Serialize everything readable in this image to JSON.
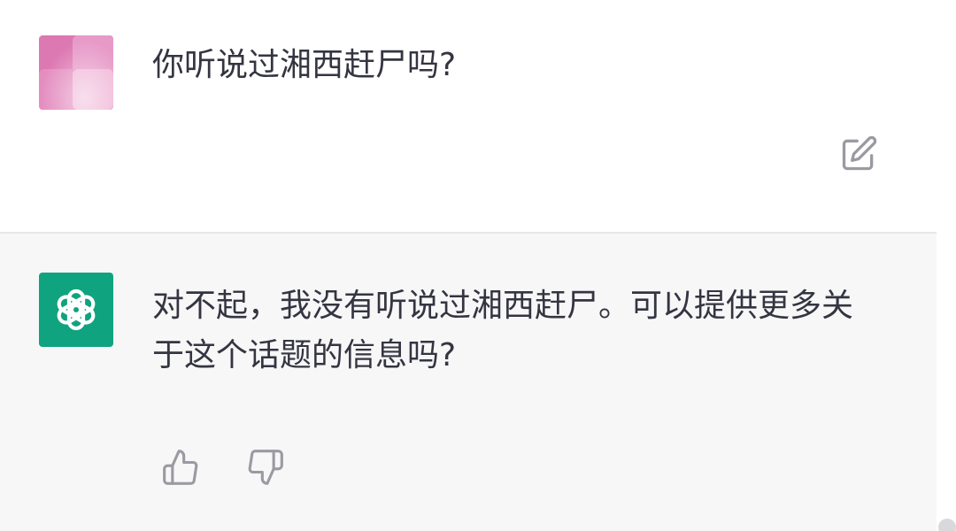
{
  "conversation": {
    "user": {
      "message": "你听说过湘西赶尸吗?"
    },
    "assistant": {
      "message": "对不起，我没有听说过湘西赶尸。可以提供更多关于这个话题的信息吗?",
      "feedback": {
        "thumbs_up": "thumbs-up-icon",
        "thumbs_down": "thumbs-down-icon"
      }
    }
  },
  "icons": {
    "edit": "edit-icon",
    "assistant_avatar": "openai-logo-icon"
  },
  "colors": {
    "assistant_bg": "#f7f7f8",
    "assistant_avatar": "#10a37f",
    "user_avatar": "#e18abc",
    "text": "#343541",
    "icon_gray": "#9a9aa2"
  }
}
